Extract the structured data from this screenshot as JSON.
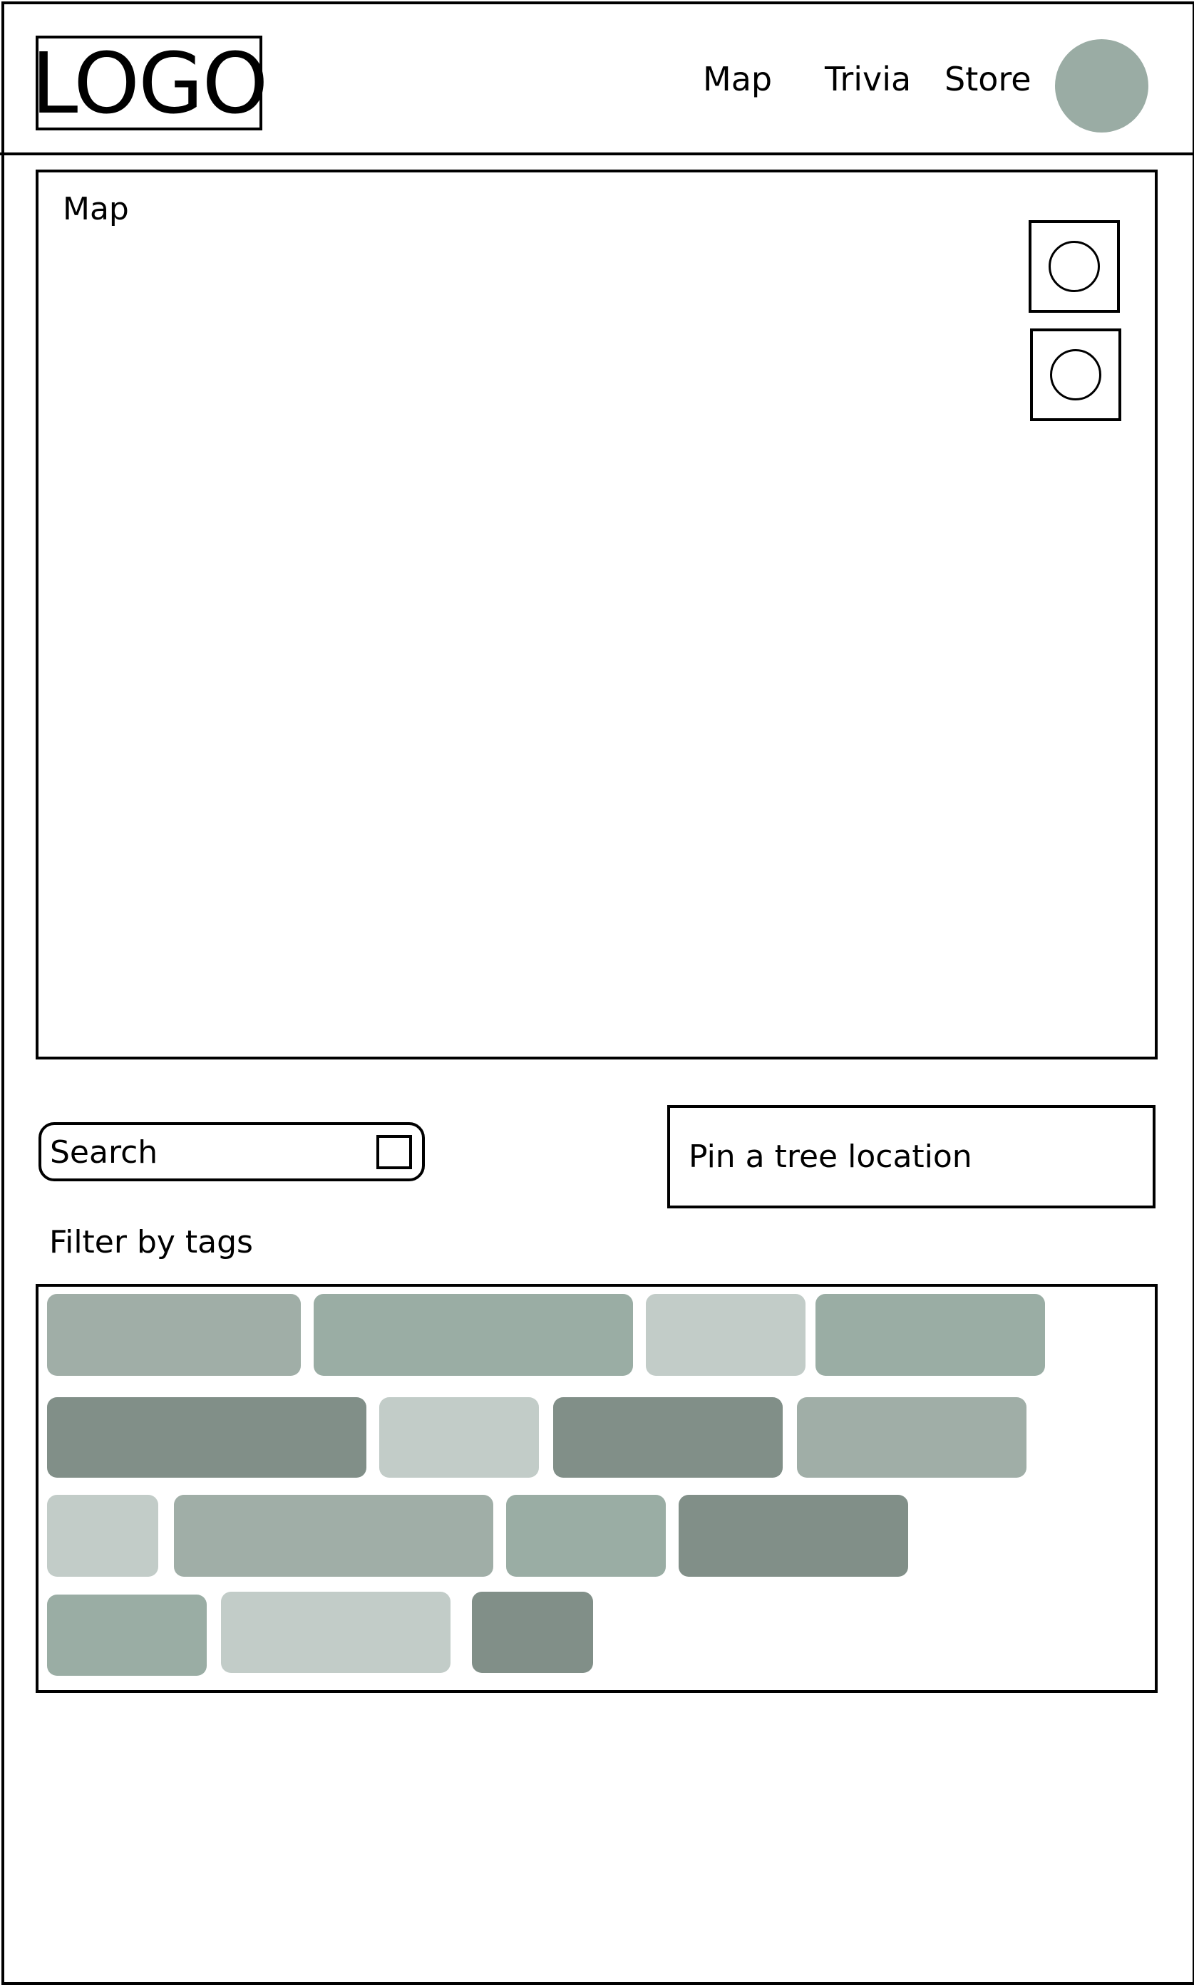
{
  "header": {
    "logo_text": "LOGO",
    "nav": {
      "map": "Map",
      "trivia": "Trivia",
      "store": "Store"
    },
    "avatar_color": "#9aaca4"
  },
  "map_panel": {
    "label": "Map",
    "controls": [
      "map-control-1",
      "map-control-2"
    ]
  },
  "search": {
    "placeholder": "Search"
  },
  "pin_button": {
    "label": "Pin a tree location"
  },
  "filter": {
    "label": "Filter by tags"
  },
  "colors": {
    "tag_gray_green": "#a0aea7",
    "tag_sage": "#9aada4",
    "tag_light": "#c2ccc8",
    "tag_dark": "#818f88",
    "border": "#000000"
  }
}
